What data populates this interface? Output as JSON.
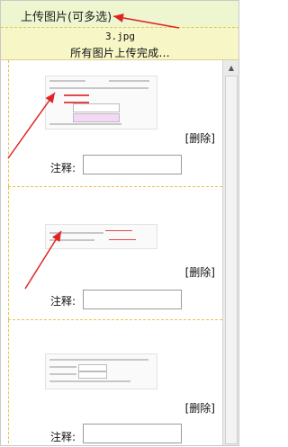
{
  "header": {
    "title": "上传图片(可多选)"
  },
  "status": {
    "file_name": "3.jpg",
    "message": "所有图片上传完成..."
  },
  "items": [
    {
      "delete_label": "[删除]",
      "note_label": "注释:",
      "note_value": ""
    },
    {
      "delete_label": "[删除]",
      "note_label": "注释:",
      "note_value": ""
    },
    {
      "delete_label": "[删除]",
      "note_label": "注释:",
      "note_value": ""
    }
  ],
  "colors": {
    "arrow": "#e02424",
    "dashed_border": "#e8c44a",
    "header_bg": "#eef6d0",
    "status_bg": "#f7f6c6"
  },
  "icons": {
    "scroll_up": "▲"
  }
}
